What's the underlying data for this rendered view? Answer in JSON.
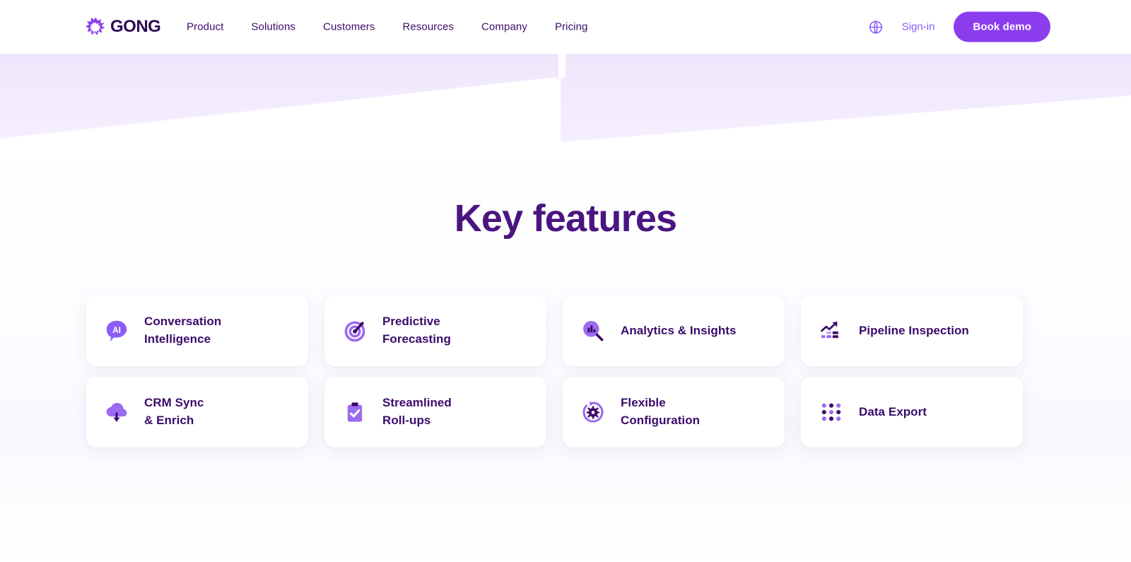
{
  "header": {
    "logo": {
      "wordmark": "GONG",
      "mark_icon": "gong-starburst-icon"
    },
    "nav_items": [
      {
        "label": "Product"
      },
      {
        "label": "Solutions"
      },
      {
        "label": "Customers"
      },
      {
        "label": "Resources"
      },
      {
        "label": "Company"
      },
      {
        "label": "Pricing"
      }
    ],
    "language_icon": "globe-icon",
    "signin_label": "Sign-in",
    "book_demo_label": "Book demo"
  },
  "hero": {
    "decorative_band": "angled-lavender-banner"
  },
  "features": {
    "title": "Key features",
    "cards": [
      {
        "label": "Conversation\nIntelligence",
        "icon": "ai-speech-bubble-icon"
      },
      {
        "label": "Predictive\nForecasting",
        "icon": "target-arrow-icon"
      },
      {
        "label": "Analytics & Insights",
        "icon": "magnifier-bar-chart-icon"
      },
      {
        "label": "Pipeline Inspection",
        "icon": "trending-up-funnel-icon"
      },
      {
        "label": "CRM Sync\n& Enrich",
        "icon": "cloud-download-icon"
      },
      {
        "label": "Streamlined\nRoll-ups",
        "icon": "clipboard-check-icon"
      },
      {
        "label": "Flexible\nConfiguration",
        "icon": "gear-refresh-icon"
      },
      {
        "label": "Data Export",
        "icon": "dot-grid-icon"
      }
    ]
  },
  "colors": {
    "brand_purple": "#8B3DEE",
    "deep_purple": "#3B0B69",
    "title_purple": "#4A1580",
    "light_purple": "#A78BFA",
    "band_lavender": "#F3EDFD",
    "white": "#FFFFFF"
  }
}
